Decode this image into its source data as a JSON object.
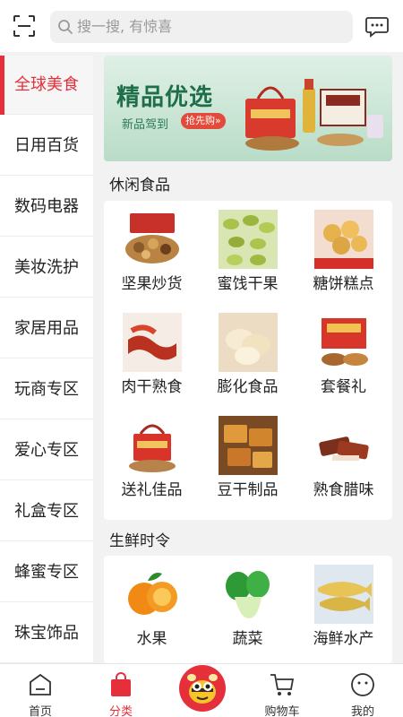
{
  "search": {
    "placeholder": "搜一搜, 有惊喜"
  },
  "sidebar": {
    "items": [
      {
        "label": "全球美食"
      },
      {
        "label": "日用百货"
      },
      {
        "label": "数码电器"
      },
      {
        "label": "美妆洗护"
      },
      {
        "label": "家居用品"
      },
      {
        "label": "玩商专区"
      },
      {
        "label": "爱心专区"
      },
      {
        "label": "礼盒专区"
      },
      {
        "label": "蜂蜜专区"
      },
      {
        "label": "珠宝饰品"
      }
    ],
    "active_index": 0
  },
  "banner": {
    "title": "精品优选",
    "subtitle": "新品驾到",
    "tag": "抢先购»"
  },
  "sections": [
    {
      "title": "休闲食品",
      "items": [
        {
          "label": "坚果炒货",
          "icon": "nuts-photo"
        },
        {
          "label": "蜜饯干果",
          "icon": "raisins-photo"
        },
        {
          "label": "糖饼糕点",
          "icon": "cookies-photo"
        },
        {
          "label": "肉干熟食",
          "icon": "jerky-photo"
        },
        {
          "label": "膨化食品",
          "icon": "chips-photo"
        },
        {
          "label": "套餐礼",
          "icon": "gift-set-photo"
        },
        {
          "label": "送礼佳品",
          "icon": "gift-box-photo"
        },
        {
          "label": "豆干制品",
          "icon": "tofu-photo"
        },
        {
          "label": "熟食腊味",
          "icon": "cured-meat-photo"
        }
      ]
    },
    {
      "title": "生鲜时令",
      "items": [
        {
          "label": "水果",
          "icon": "orange-photo"
        },
        {
          "label": "蔬菜",
          "icon": "bok-choy-photo"
        },
        {
          "label": "海鲜水产",
          "icon": "fish-photo"
        }
      ]
    }
  ],
  "bottom_nav": {
    "items": [
      {
        "label": "首页",
        "icon": "home-icon"
      },
      {
        "label": "分类",
        "icon": "shopping-bag-icon"
      },
      {
        "label": "",
        "icon": "bee-mascot-icon"
      },
      {
        "label": "购物车",
        "icon": "cart-icon"
      },
      {
        "label": "我的",
        "icon": "profile-icon"
      }
    ],
    "active_index": 1
  },
  "colors": {
    "accent": "#e5303b",
    "banner_green": "#1f6e4a"
  }
}
